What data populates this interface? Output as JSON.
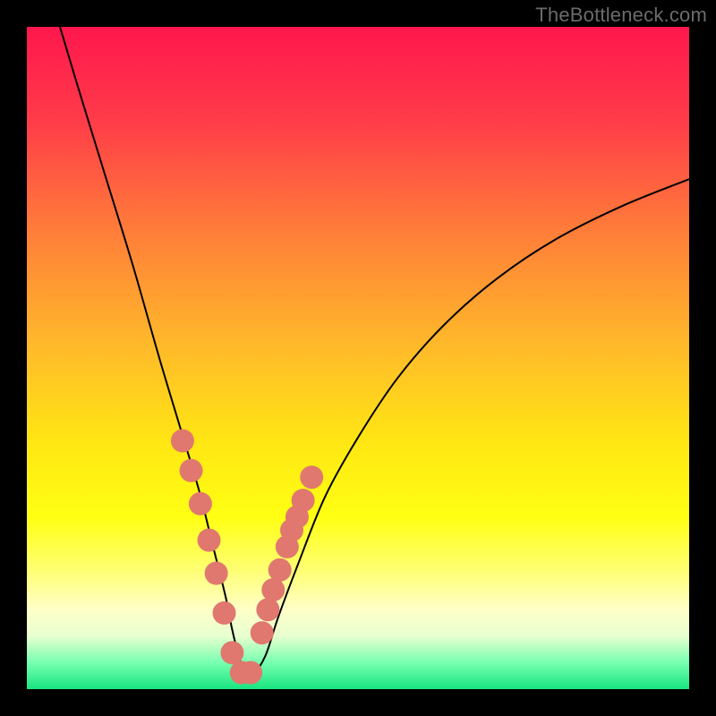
{
  "watermark": "TheBottleneck.com",
  "colors": {
    "gradient_stops": [
      {
        "pct": 0,
        "color": "#ff174d"
      },
      {
        "pct": 14,
        "color": "#ff3b49"
      },
      {
        "pct": 30,
        "color": "#ff7a3a"
      },
      {
        "pct": 48,
        "color": "#ffb92a"
      },
      {
        "pct": 63,
        "color": "#ffe713"
      },
      {
        "pct": 74,
        "color": "#ffff13"
      },
      {
        "pct": 82,
        "color": "#ffff73"
      },
      {
        "pct": 88,
        "color": "#ffffc8"
      },
      {
        "pct": 92,
        "color": "#e7ffcf"
      },
      {
        "pct": 96,
        "color": "#77ffb0"
      },
      {
        "pct": 100,
        "color": "#17e57f"
      }
    ],
    "dot": "#e0786f",
    "curve": "#000000",
    "frame": "#000000",
    "watermark": "#6b6b6b"
  },
  "chart_data": {
    "type": "line",
    "title": "",
    "xlabel": "",
    "ylabel": "",
    "xlim": [
      0,
      100
    ],
    "ylim": [
      0,
      100
    ],
    "series": [
      {
        "name": "bottleneck-curve",
        "x": [
          5,
          8,
          12,
          16,
          20,
          23,
          26,
          28,
          30,
          31,
          32,
          33,
          34,
          36,
          38,
          41,
          45,
          50,
          56,
          63,
          71,
          80,
          90,
          100
        ],
        "y": [
          100,
          90,
          77,
          64,
          50,
          40,
          30,
          22,
          14,
          9,
          5,
          2,
          2,
          5,
          11,
          19,
          29,
          38,
          47,
          55,
          62,
          68,
          73,
          77
        ]
      }
    ],
    "dots": {
      "name": "highlighted-points",
      "x": [
        23.5,
        24.8,
        26.2,
        27.5,
        28.6,
        29.8,
        31.0,
        32.4,
        33.8,
        35.5,
        36.4,
        37.2,
        38.2,
        39.3,
        40.0,
        40.8,
        41.7,
        43.0
      ],
      "y": [
        37.5,
        33.0,
        28.0,
        22.5,
        17.5,
        11.5,
        5.5,
        2.5,
        2.5,
        8.5,
        12.0,
        15.0,
        18.0,
        21.5,
        24.0,
        26.0,
        28.5,
        32.0
      ]
    }
  }
}
